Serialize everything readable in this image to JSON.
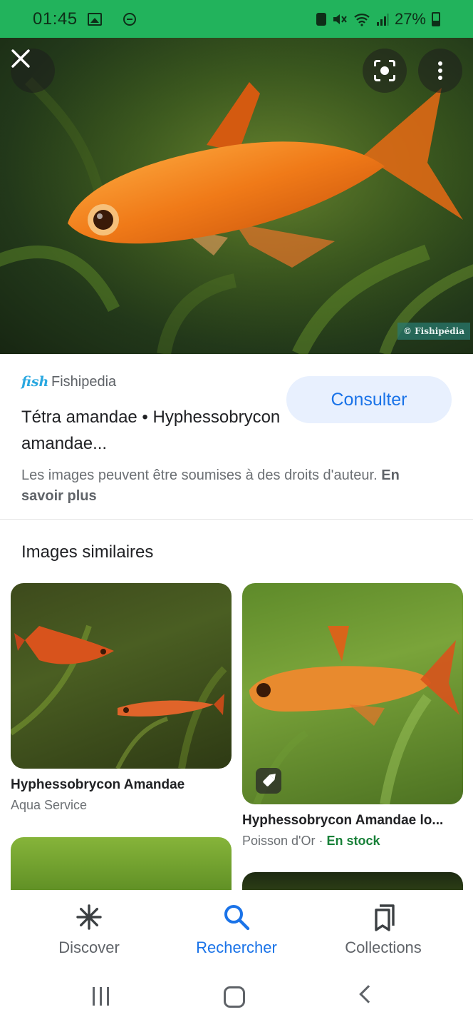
{
  "status_bar": {
    "time": "01:45",
    "battery": "27%",
    "icons": [
      "gallery-icon",
      "dnd-icon",
      "alarm-icon",
      "mute-icon",
      "wifi-icon",
      "signal-icon",
      "battery-icon"
    ]
  },
  "hero": {
    "image_credit": "© Fishipédia",
    "close_icon": "×"
  },
  "result": {
    "source_logo": "fish",
    "source_name": "Fishipedia",
    "title": "Tétra amandae • Hyphessobrycon amandae...",
    "visit_label": "Consulter",
    "copyright_text": "Les images peuvent être soumises à des droits d'auteur.",
    "learn_more": "En savoir plus"
  },
  "similar": {
    "heading": "Images similaires",
    "items": [
      {
        "title": "Hyphessobrycon Amandae",
        "source": "Aqua Service"
      },
      {
        "title": "Hyphessobrycon Amandae lo...",
        "source": "Poisson d'Or · ",
        "stock": "En stock"
      }
    ]
  },
  "bottom_nav": {
    "items": [
      {
        "label": "Discover",
        "icon": "asterisk-icon"
      },
      {
        "label": "Rechercher",
        "icon": "search-icon",
        "active": true
      },
      {
        "label": "Collections",
        "icon": "collections-icon"
      }
    ]
  },
  "colors": {
    "status_bar": "#22b35c",
    "accent": "#1a73e8",
    "button_bg": "#e8f0fe",
    "in_stock": "#188038"
  }
}
